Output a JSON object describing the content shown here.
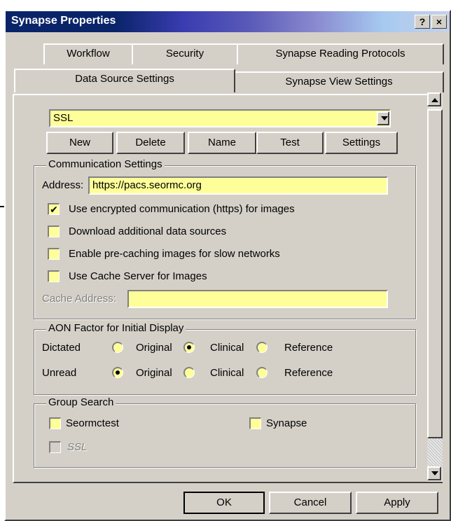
{
  "window": {
    "title": "Synapse Properties",
    "help_button": "?",
    "close_button": "×"
  },
  "tabs": {
    "row_back": [
      "Workflow",
      "Security",
      "Synapse Reading Protocols"
    ],
    "row_front": [
      "Data Source Settings",
      "Synapse View Settings"
    ],
    "active": "Data Source Settings"
  },
  "data_source": {
    "selected": "SSL",
    "buttons": [
      "New",
      "Delete",
      "Name",
      "Test",
      "Settings"
    ]
  },
  "communication": {
    "legend": "Communication Settings",
    "address_label": "Address:",
    "address_value": "https://pacs.seormc.org",
    "options": [
      {
        "label": "Use encrypted communication (https) for images",
        "checked": true
      },
      {
        "label": "Download additional data sources",
        "checked": false
      },
      {
        "label": "Enable pre-caching images for slow networks",
        "checked": false
      },
      {
        "label": "Use Cache Server for Images",
        "checked": false
      }
    ],
    "cache_label": "Cache Address:",
    "cache_value": ""
  },
  "aon": {
    "legend": "AON Factor for Initial Display",
    "rows": [
      {
        "label": "Dictated",
        "selected": "Clinical"
      },
      {
        "label": "Unread",
        "selected": "Original"
      }
    ],
    "choices": [
      "Original",
      "Clinical",
      "Reference"
    ]
  },
  "group_search": {
    "legend": "Group Search",
    "items": [
      {
        "label": "Seormctest",
        "checked": false,
        "enabled": true
      },
      {
        "label": "Synapse",
        "checked": false,
        "enabled": true
      },
      {
        "label": "SSL",
        "checked": false,
        "enabled": false
      }
    ]
  },
  "footer": {
    "ok": "OK",
    "cancel": "Cancel",
    "apply": "Apply"
  },
  "colors": {
    "title_bar": "#0a246a",
    "field_bg": "#ffff99",
    "dialog_bg": "#d4d0c8"
  }
}
